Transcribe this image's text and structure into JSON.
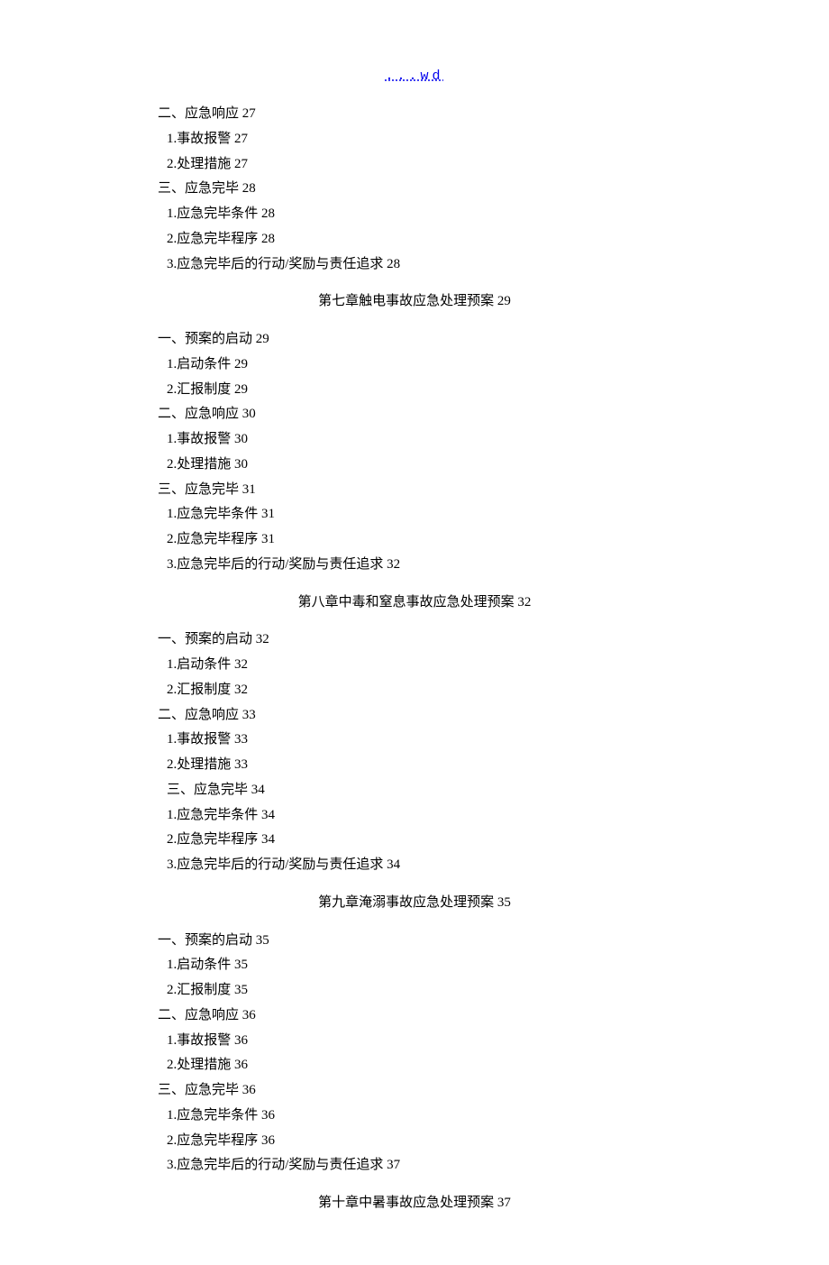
{
  "header": {
    "link_text": "...wd"
  },
  "sections": [
    {
      "type": "line",
      "indent": false,
      "text": "二、应急响应 27"
    },
    {
      "type": "line",
      "indent": true,
      "text": "1.事故报警 27"
    },
    {
      "type": "line",
      "indent": true,
      "text": "2.处理措施 27"
    },
    {
      "type": "line",
      "indent": false,
      "text": "三、应急完毕 28"
    },
    {
      "type": "line",
      "indent": true,
      "text": "1.应急完毕条件 28"
    },
    {
      "type": "line",
      "indent": true,
      "text": "2.应急完毕程序 28"
    },
    {
      "type": "line",
      "indent": true,
      "text": "3.应急完毕后的行动/奖励与责任追求 28"
    },
    {
      "type": "chapter",
      "text": "第七章触电事故应急处理预案 29"
    },
    {
      "type": "line",
      "indent": false,
      "text": "一、预案的启动 29"
    },
    {
      "type": "line",
      "indent": true,
      "text": "1.启动条件 29"
    },
    {
      "type": "line",
      "indent": true,
      "text": "2.汇报制度 29"
    },
    {
      "type": "line",
      "indent": false,
      "text": "二、应急响应 30"
    },
    {
      "type": "line",
      "indent": true,
      "text": "1.事故报警 30"
    },
    {
      "type": "line",
      "indent": true,
      "text": "2.处理措施 30"
    },
    {
      "type": "line",
      "indent": false,
      "text": "三、应急完毕 31"
    },
    {
      "type": "line",
      "indent": true,
      "text": "1.应急完毕条件 31"
    },
    {
      "type": "line",
      "indent": true,
      "text": "2.应急完毕程序 31"
    },
    {
      "type": "line",
      "indent": true,
      "text": "3.应急完毕后的行动/奖励与责任追求 32"
    },
    {
      "type": "chapter",
      "text": "第八章中毒和窒息事故应急处理预案 32"
    },
    {
      "type": "line",
      "indent": false,
      "text": "一、预案的启动 32"
    },
    {
      "type": "line",
      "indent": true,
      "text": "1.启动条件 32"
    },
    {
      "type": "line",
      "indent": true,
      "text": "2.汇报制度 32"
    },
    {
      "type": "line",
      "indent": false,
      "text": "二、应急响应 33"
    },
    {
      "type": "line",
      "indent": true,
      "text": "1.事故报警 33"
    },
    {
      "type": "line",
      "indent": true,
      "text": "2.处理措施 33"
    },
    {
      "type": "line",
      "indent": true,
      "text": "三、应急完毕 34"
    },
    {
      "type": "line",
      "indent": true,
      "text": "1.应急完毕条件 34"
    },
    {
      "type": "line",
      "indent": true,
      "text": "2.应急完毕程序 34"
    },
    {
      "type": "line",
      "indent": true,
      "text": "3.应急完毕后的行动/奖励与责任追求 34"
    },
    {
      "type": "chapter",
      "text": "第九章淹溺事故应急处理预案 35"
    },
    {
      "type": "line",
      "indent": false,
      "text": "一、预案的启动 35"
    },
    {
      "type": "line",
      "indent": true,
      "text": "1.启动条件 35"
    },
    {
      "type": "line",
      "indent": true,
      "text": "2.汇报制度 35"
    },
    {
      "type": "line",
      "indent": false,
      "text": "二、应急响应 36"
    },
    {
      "type": "line",
      "indent": true,
      "text": "1.事故报警 36"
    },
    {
      "type": "line",
      "indent": true,
      "text": "2.处理措施 36"
    },
    {
      "type": "line",
      "indent": false,
      "text": "三、应急完毕 36"
    },
    {
      "type": "line",
      "indent": true,
      "text": "1.应急完毕条件 36"
    },
    {
      "type": "line",
      "indent": true,
      "text": "2.应急完毕程序 36"
    },
    {
      "type": "line",
      "indent": true,
      "text": "3.应急完毕后的行动/奖励与责任追求 37"
    },
    {
      "type": "chapter",
      "text": "第十章中暑事故应急处理预案 37"
    }
  ]
}
